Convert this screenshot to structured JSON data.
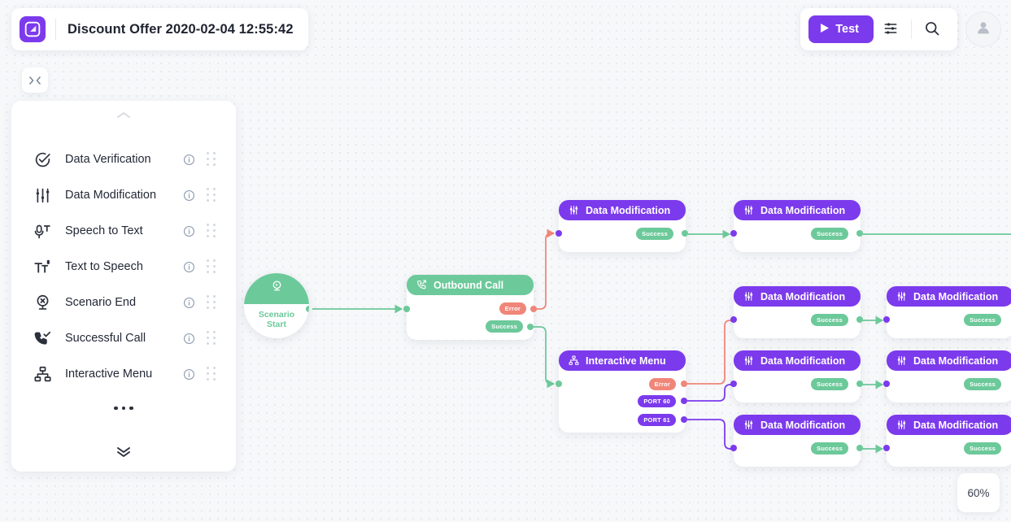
{
  "header": {
    "title": "Discount Offer 2020-02-04 12:55:42",
    "logo_icon": "app-logo-icon",
    "test_label": "Test",
    "play_icon": "play-icon",
    "settings_icon": "sliders-settings-icon",
    "search_icon": "search-icon",
    "avatar_icon": "user-avatar-icon"
  },
  "canvas": {
    "collapse_label": "›‹",
    "zoom_level": "60%"
  },
  "sidebar": {
    "collapse_up_icon": "chevron-up-icon",
    "expand_down_icon": "chevron-down-icon",
    "more_icon": "more-dots-icon",
    "items": [
      {
        "label": "Data Verification",
        "icon": "check-circle-icon",
        "info_icon": "info-icon",
        "grip_icon": "drag-handle-icon"
      },
      {
        "label": "Data Modification",
        "icon": "sliders-icon",
        "info_icon": "info-icon",
        "grip_icon": "drag-handle-icon"
      },
      {
        "label": "Speech to Text",
        "icon": "microphone-text-icon",
        "info_icon": "info-icon",
        "grip_icon": "drag-handle-icon"
      },
      {
        "label": "Text to Speech",
        "icon": "text-microphone-icon",
        "info_icon": "info-icon",
        "grip_icon": "drag-handle-icon"
      },
      {
        "label": "Scenario End",
        "icon": "stop-circle-icon",
        "info_icon": "info-icon",
        "grip_icon": "drag-handle-icon"
      },
      {
        "label": "Successful Call",
        "icon": "phone-check-icon",
        "info_icon": "info-icon",
        "grip_icon": "drag-handle-icon"
      },
      {
        "label": "Interactive Menu",
        "icon": "sitemap-icon",
        "info_icon": "info-icon",
        "grip_icon": "drag-handle-icon"
      }
    ]
  },
  "flow": {
    "start_node": {
      "line1": "Scenario",
      "line2": "Start",
      "icon": "play-circle-icon"
    },
    "nodes": [
      {
        "id": "outbound-call",
        "title": "Outbound Call",
        "icon": "phone-outgoing-icon",
        "color": "green",
        "ports": [
          "Error",
          "Success"
        ]
      },
      {
        "id": "data-mod-1",
        "title": "Data Modification",
        "icon": "sliders-icon",
        "color": "purple",
        "ports": [
          "Success"
        ]
      },
      {
        "id": "data-mod-2",
        "title": "Data Modification",
        "icon": "sliders-icon",
        "color": "purple",
        "ports": [
          "Success"
        ]
      },
      {
        "id": "interactive-menu",
        "title": "Interactive Menu",
        "icon": "sitemap-icon",
        "color": "purple",
        "ports": [
          "Error",
          "PORT 60",
          "PORT 61"
        ]
      },
      {
        "id": "data-mod-3",
        "title": "Data Modification",
        "icon": "sliders-icon",
        "color": "purple",
        "ports": [
          "Success"
        ]
      },
      {
        "id": "data-mod-4",
        "title": "Data Modification",
        "icon": "sliders-icon",
        "color": "purple",
        "ports": [
          "Success"
        ]
      },
      {
        "id": "data-mod-5",
        "title": "Data Modification",
        "icon": "sliders-icon",
        "color": "purple",
        "ports": [
          "Success"
        ]
      },
      {
        "id": "data-mod-6",
        "title": "Data Modification",
        "icon": "sliders-icon",
        "color": "purple",
        "ports": [
          "Success"
        ]
      },
      {
        "id": "data-mod-7",
        "title": "Data Modification",
        "icon": "sliders-icon",
        "color": "purple",
        "ports": [
          "Success"
        ]
      },
      {
        "id": "data-mod-8",
        "title": "Data Modification",
        "icon": "sliders-icon",
        "color": "purple",
        "ports": [
          "Success"
        ]
      }
    ],
    "port_labels": {
      "success": "Success",
      "error": "Error",
      "port60": "PORT 60",
      "port61": "PORT 61"
    }
  },
  "colors": {
    "accent_purple": "#7c3aed",
    "success_green": "#6cc99a",
    "error_salmon": "#f08679",
    "canvas_bg": "#f7f8fa",
    "dot_grid": "#e2e5eb"
  }
}
